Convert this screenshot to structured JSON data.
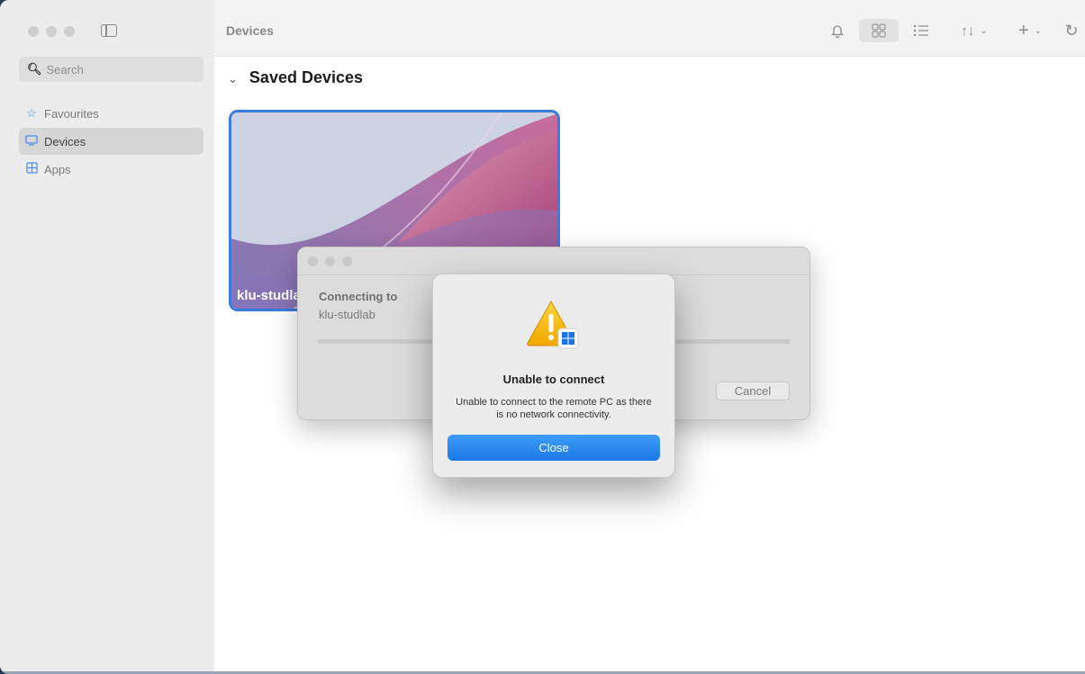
{
  "sidebar": {
    "search_placeholder": "Search",
    "items": [
      {
        "label": "Favourites",
        "icon": "star-icon",
        "active": false
      },
      {
        "label": "Devices",
        "icon": "monitor-icon",
        "active": true
      },
      {
        "label": "Apps",
        "icon": "apps-grid-icon",
        "active": false
      }
    ]
  },
  "toolbar": {
    "title": "Devices",
    "icons": [
      "bell-icon",
      "grid-view-icon",
      "list-view-icon",
      "sort-icon",
      "add-icon",
      "refresh-icon"
    ]
  },
  "main": {
    "section_title": "Saved Devices",
    "devices": [
      {
        "name": "klu-studlab"
      }
    ]
  },
  "connecting_dialog": {
    "label": "Connecting to",
    "host": "klu-studlab",
    "cancel_label": "Cancel",
    "progress": 0
  },
  "alert": {
    "title": "Unable to connect",
    "message": "Unable to connect to the remote PC as there is no network connectivity.",
    "close_label": "Close"
  },
  "colors": {
    "accent": "#1b78e8",
    "selection_border": "#3a7be0",
    "sidebar_icon": "#4a8ee8"
  }
}
